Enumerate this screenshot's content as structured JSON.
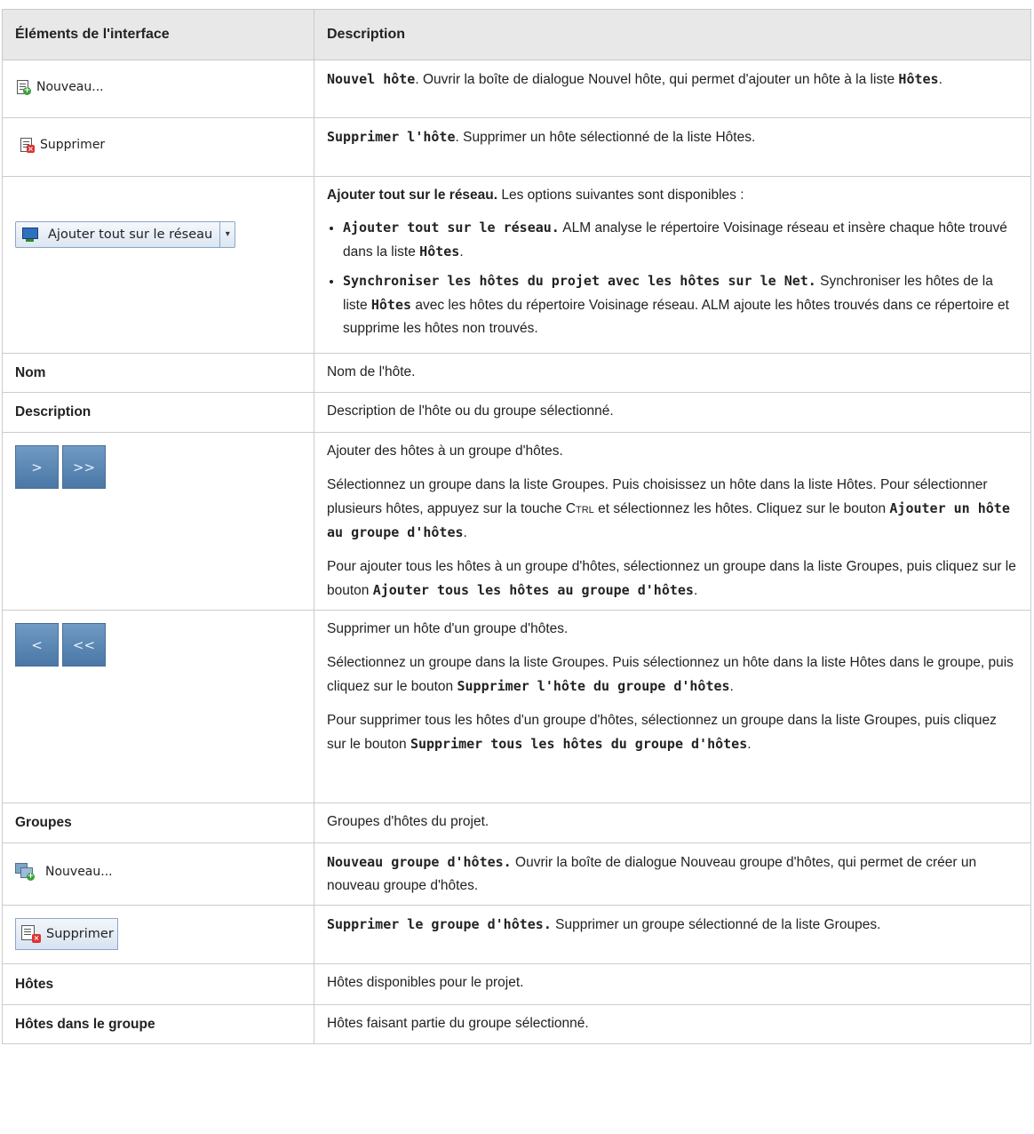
{
  "header": {
    "col1": "Éléments de l'interface",
    "col2": "Description"
  },
  "rows": {
    "new_host": {
      "button_label": "Nouveau...",
      "title": "Nouvel hôte",
      "text": ". Ouvrir la boîte de dialogue Nouvel hôte, qui permet d'ajouter un hôte à la liste ",
      "hosts_word": "Hôtes",
      "end": "."
    },
    "delete_host": {
      "button_label": "Supprimer",
      "title": "Supprimer l'hôte",
      "text": ". Supprimer un hôte sélectionné de la liste Hôtes."
    },
    "add_all": {
      "button_label": "Ajouter tout sur le réseau",
      "dropdown_glyph": "▾",
      "title": "Ajouter tout sur le réseau.",
      "intro": " Les options suivantes sont disponibles :",
      "opt1_title": "Ajouter tout sur le réseau.",
      "opt1_text": " ALM analyse le répertoire Voisinage réseau et insère chaque hôte trouvé dans la liste ",
      "opt1_hosts": "Hôtes",
      "opt1_end": ".",
      "opt2_title": "Synchroniser les hôtes du projet avec les hôtes sur le Net.",
      "opt2_text1": " Synchroniser les hôtes de la liste ",
      "opt2_hosts": "Hôtes",
      "opt2_text2": " avec les hôtes du répertoire Voisinage réseau. ALM ajoute les hôtes trouvés dans ce répertoire et supprime les hôtes non trouvés."
    },
    "name": {
      "label": "Nom",
      "text": "Nom de l'hôte."
    },
    "description": {
      "label": "Description",
      "text": "Description de l'hôte ou du groupe sélectionné."
    },
    "add_to_group": {
      "btn1": ">",
      "btn2": ">>",
      "p1": "Ajouter des hôtes à un groupe d'hôtes.",
      "p2a": "Sélectionnez un groupe dans la liste Groupes. Puis choisissez un hôte dans la liste Hôtes. Pour sélectionner plusieurs hôtes, appuyez sur la touche ",
      "ctrl": "Ctrl",
      "p2b": " et sélectionnez les hôtes. Cliquez sur le bouton ",
      "p2_bold": "Ajouter un hôte au groupe d'hôtes",
      "p2_end": ".",
      "p3a": "Pour ajouter tous les hôtes à un groupe d'hôtes, sélectionnez un groupe dans la liste Groupes, puis cliquez sur le bouton ",
      "p3_bold": "Ajouter tous les hôtes au groupe d'hôtes",
      "p3_end": "."
    },
    "remove_from_group": {
      "btn1": "<",
      "btn2": "<<",
      "p1": "Supprimer un hôte d'un groupe d'hôtes.",
      "p2a": "Sélectionnez un groupe dans la liste Groupes. Puis sélectionnez un hôte dans la liste Hôtes dans le groupe, puis cliquez sur le bouton ",
      "p2_bold": "Supprimer l'hôte du groupe d'hôtes",
      "p2_end": ".",
      "p3a": "Pour supprimer tous les hôtes d'un groupe d'hôtes, sélectionnez un groupe dans la liste Groupes, puis cliquez sur le bouton ",
      "p3_bold": "Supprimer tous les hôtes du groupe d'hôtes",
      "p3_end": "."
    },
    "groups": {
      "label": "Groupes",
      "text": "Groupes d'hôtes du projet."
    },
    "new_group": {
      "button_label": "Nouveau...",
      "title": "Nouveau groupe d'hôtes.",
      "text": " Ouvrir la boîte de dialogue Nouveau groupe d'hôtes, qui permet de créer un nouveau groupe d'hôtes."
    },
    "delete_group": {
      "button_label": "Supprimer",
      "title": "Supprimer le groupe d'hôtes.",
      "text": " Supprimer un groupe sélectionné de la liste Groupes."
    },
    "hosts": {
      "label": "Hôtes",
      "text": "Hôtes disponibles pour le projet."
    },
    "hosts_in_group": {
      "label": "Hôtes dans le groupe",
      "text": "Hôtes faisant partie du groupe sélectionné."
    }
  }
}
